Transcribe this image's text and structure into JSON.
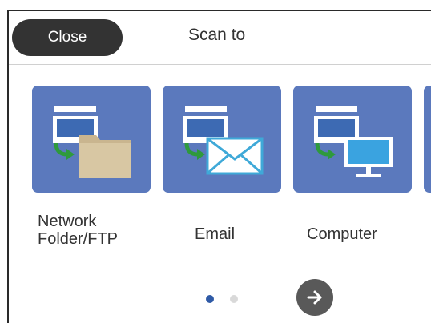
{
  "header": {
    "close_label": "Close",
    "title": "Scan to"
  },
  "tiles": [
    {
      "label_line1": "Network",
      "label_line2": "Folder/FTP",
      "icon": "scan-to-network-folder-icon"
    },
    {
      "label": "Email",
      "icon": "scan-to-email-icon"
    },
    {
      "label": "Computer",
      "icon": "scan-to-computer-icon"
    }
  ],
  "pagination": {
    "current_page": 1,
    "total_pages": 2,
    "active_color": "#2f5aa6",
    "inactive_color": "#d9d9d9"
  },
  "colors": {
    "tile_background": "#5b79bd",
    "close_button": "#333333",
    "next_button": "#595959"
  },
  "next_icon": "arrow-right-icon"
}
